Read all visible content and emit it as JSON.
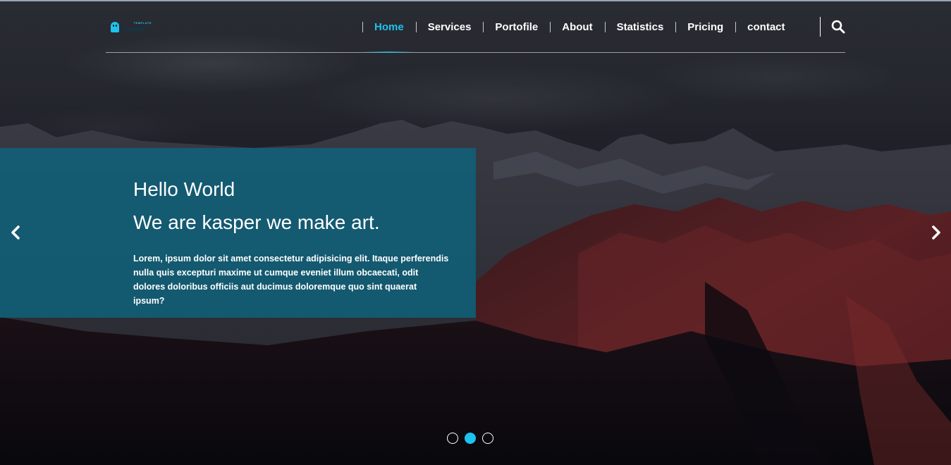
{
  "header": {
    "logo": {
      "template_text": "TEMPLATE",
      "brand_text": "Kasper",
      "accent_color": "#1ec2ee"
    },
    "nav": [
      {
        "label": "Home",
        "active": true
      },
      {
        "label": "Services",
        "active": false
      },
      {
        "label": "Portofile",
        "active": false
      },
      {
        "label": "About",
        "active": false
      },
      {
        "label": "Statistics",
        "active": false
      },
      {
        "label": "Pricing",
        "active": false
      },
      {
        "label": "contact",
        "active": false
      }
    ],
    "search_icon": "search-icon"
  },
  "hero": {
    "title": "Hello World",
    "subtitle": "We are kasper we make art.",
    "paragraph": "Lorem, ipsum dolor sit amet consectetur adipisicing elit. Itaque perferendis nulla quis excepturi maxime ut cumque eveniet illum obcaecati, odit dolores doloribus officiis aut ducimus doloremque quo sint quaerat ipsum?",
    "box_color": "#0e637c",
    "prev_icon": "chevron-left-icon",
    "next_icon": "chevron-right-icon"
  },
  "slider": {
    "slide_count": 3,
    "active_slide": 2,
    "active_color": "#1ec2ee"
  }
}
